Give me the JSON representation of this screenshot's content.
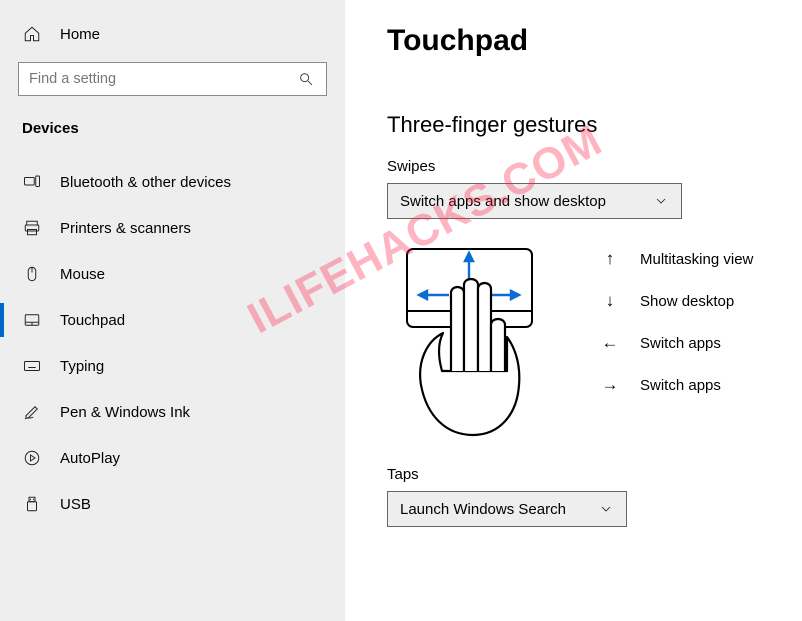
{
  "sidebar": {
    "home": "Home",
    "search_placeholder": "Find a setting",
    "section": "Devices",
    "items": [
      {
        "label": "Bluetooth & other devices"
      },
      {
        "label": "Printers & scanners"
      },
      {
        "label": "Mouse"
      },
      {
        "label": "Touchpad"
      },
      {
        "label": "Typing"
      },
      {
        "label": "Pen & Windows Ink"
      },
      {
        "label": "AutoPlay"
      },
      {
        "label": "USB"
      }
    ]
  },
  "main": {
    "title": "Touchpad",
    "section": "Three-finger gestures",
    "swipes_label": "Swipes",
    "swipes_value": "Switch apps and show desktop",
    "legend": {
      "up": "Multitasking view",
      "down": "Show desktop",
      "left": "Switch apps",
      "right": "Switch apps"
    },
    "taps_label": "Taps",
    "taps_value": "Launch Windows Search"
  },
  "watermark": "ILIFEHACKS.COM"
}
